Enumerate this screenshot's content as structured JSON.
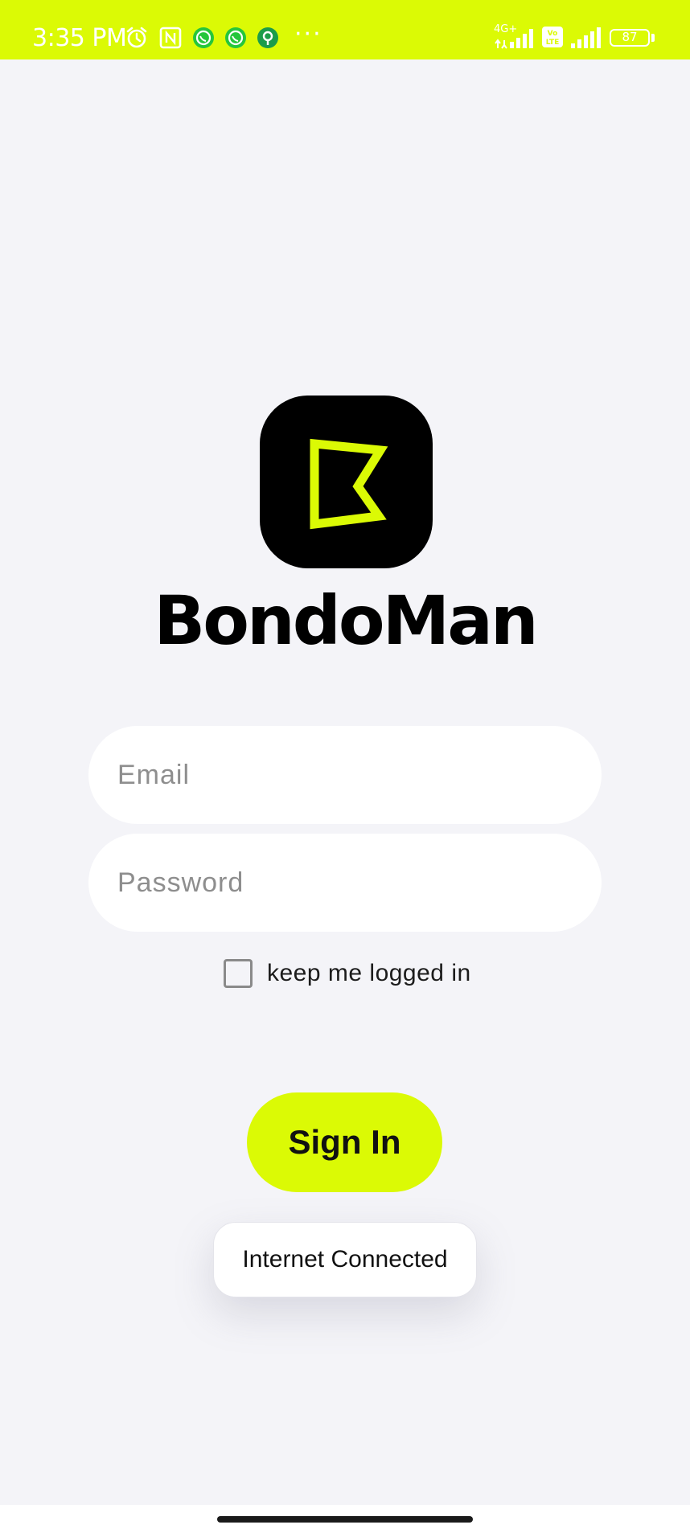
{
  "status_bar": {
    "time": "3:35 PM",
    "battery_level": "87",
    "network_label": "4G+",
    "volte_label": "Vo LTE",
    "overflow": "···",
    "icons": [
      "alarm-icon",
      "nfc-icon",
      "whatsapp-icon",
      "whatsapp-icon",
      "location-app-icon",
      "signal-icon",
      "volte-icon",
      "signal-icon",
      "battery-icon"
    ],
    "background_color": "#dbfa05"
  },
  "app": {
    "name": "BondoMan",
    "logo_icon": "bondoman-logo-icon",
    "accent_color": "#dbfa05"
  },
  "login_form": {
    "email_placeholder": "Email",
    "password_placeholder": "Password",
    "remember_label": "keep me logged in",
    "remember_checked": false,
    "sign_in_label": "Sign In"
  },
  "toast": {
    "message": "Internet Connected"
  }
}
